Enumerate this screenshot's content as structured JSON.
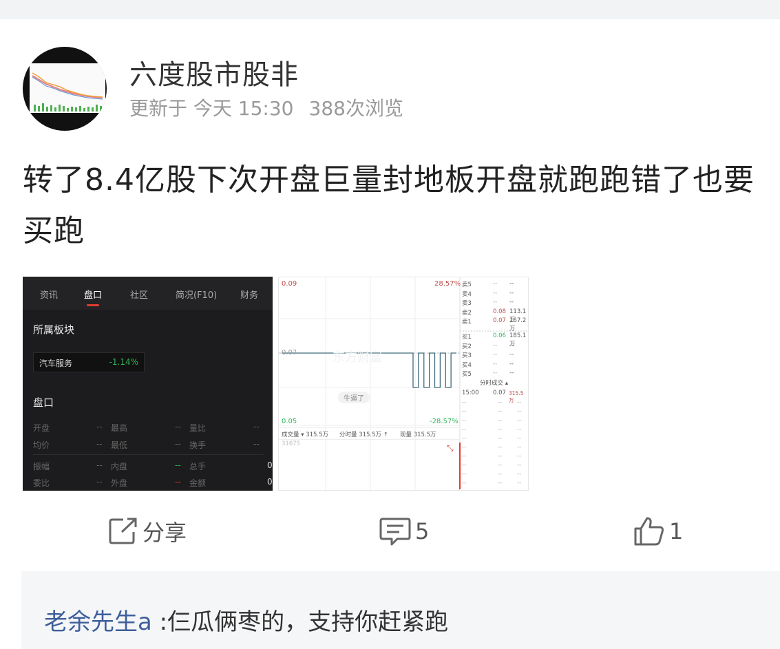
{
  "author": {
    "name": "六度股市股非",
    "updated": "更新于 今天 15:30",
    "views": "388次浏览"
  },
  "post": {
    "text": "转了8.4亿股下次开盘巨量封地板开盘就跑跑错了也要买跑"
  },
  "image1": {
    "tabs": [
      "资讯",
      "盘口",
      "社区",
      "简况(F10)",
      "财务"
    ],
    "active_tab": "盘口",
    "section_sector": "所属板块",
    "sector_name": "汽车服务",
    "sector_change": "-1.14%",
    "section_quote": "盘口",
    "rows": [
      [
        "开盘",
        "--",
        "最高",
        "--",
        "量比",
        "--"
      ],
      [
        "均价",
        "--",
        "最低",
        "--",
        "换手",
        "--"
      ],
      [
        "振幅",
        "--",
        "内盘",
        "--",
        "总手",
        "0"
      ],
      [
        "委比",
        "--",
        "外盘",
        "--",
        "金额",
        "0"
      ]
    ],
    "colors": {
      "down": "#2fb65b",
      "up": "#e03c31"
    }
  },
  "image2": {
    "price_high": "0.09",
    "price_mid": "0.07",
    "price_low": "0.05",
    "pct_high": "28.57%",
    "pct_low": "-28.57%",
    "watermark": "东方财富",
    "badge": "牛逼了",
    "volume_bar": [
      "成交量 ▾ 315.5万",
      "分时量 315.5万 ↑",
      "现量 315.5万"
    ],
    "vol_axis": "31675",
    "order_book_sell": [
      [
        "卖5",
        "--",
        "--"
      ],
      [
        "卖4",
        "--",
        "--"
      ],
      [
        "卖3",
        "--",
        "--"
      ],
      [
        "卖2",
        "0.08",
        "113.1万"
      ],
      [
        "卖1",
        "0.07",
        "167.2万"
      ]
    ],
    "order_book_buy": [
      [
        "买1",
        "0.06",
        "185.1万"
      ],
      [
        "买2",
        "--",
        "--"
      ],
      [
        "买3",
        "--",
        "--"
      ],
      [
        "买4",
        "--",
        "--"
      ],
      [
        "买5",
        "--",
        "--"
      ]
    ],
    "ticks_title": "分时成交 ▴",
    "tick_first": [
      "15:00",
      "0.07",
      "315.5万"
    ],
    "chart_data": {
      "type": "line",
      "ylim": [
        0.05,
        0.09
      ],
      "series": [
        {
          "values": [
            0.07,
            0.07,
            0.07,
            0.07,
            0.07,
            0.07,
            0.07,
            0.07,
            0.07,
            0.07,
            0.07,
            0.07,
            0.07,
            0.07,
            0.07,
            0.07,
            0.06,
            0.07,
            0.06,
            0.07,
            0.06,
            0.07,
            0.06,
            0.07
          ]
        }
      ]
    }
  },
  "actions": {
    "share": "分享",
    "comments": "5",
    "likes": "1"
  },
  "comment": {
    "user": "老余先生a",
    "text": " :仨瓜俩枣的，支持你赶紧跑"
  }
}
